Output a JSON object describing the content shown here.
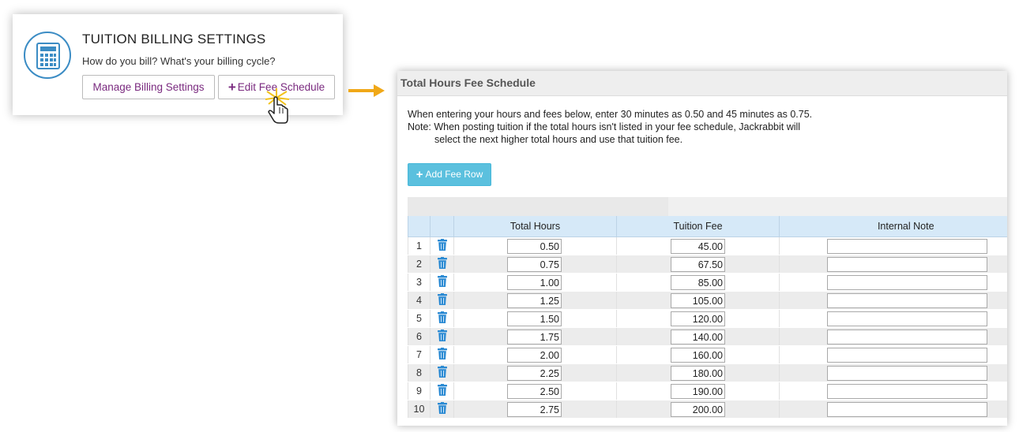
{
  "card": {
    "title": "TUITION BILLING SETTINGS",
    "subtitle": "How do you bill? What's your billing cycle?",
    "manage_label": "Manage Billing Settings",
    "edit_label": "Edit Fee Schedule",
    "icon": "calculator-icon"
  },
  "panel": {
    "title": "Total Hours Fee Schedule",
    "instr_line1": "When entering your hours and fees below, enter 30 minutes as 0.50 and 45 minutes as 0.75.",
    "instr_line2": "Note: When posting tuition if the total hours isn't listed in your fee schedule, Jackrabbit will",
    "instr_line3": "select the next higher total hours and use that tuition fee.",
    "add_row_label": "Add Fee Row",
    "columns": [
      "",
      "",
      "Total Hours",
      "Tuition Fee",
      "Internal Note"
    ],
    "rows": [
      {
        "n": "1",
        "hours": "0.50",
        "fee": "45.00",
        "note": ""
      },
      {
        "n": "2",
        "hours": "0.75",
        "fee": "67.50",
        "note": ""
      },
      {
        "n": "3",
        "hours": "1.00",
        "fee": "85.00",
        "note": ""
      },
      {
        "n": "4",
        "hours": "1.25",
        "fee": "105.00",
        "note": ""
      },
      {
        "n": "5",
        "hours": "1.50",
        "fee": "120.00",
        "note": ""
      },
      {
        "n": "6",
        "hours": "1.75",
        "fee": "140.00",
        "note": ""
      },
      {
        "n": "7",
        "hours": "2.00",
        "fee": "160.00",
        "note": ""
      },
      {
        "n": "8",
        "hours": "2.25",
        "fee": "180.00",
        "note": ""
      },
      {
        "n": "9",
        "hours": "2.50",
        "fee": "190.00",
        "note": ""
      },
      {
        "n": "10",
        "hours": "2.75",
        "fee": "200.00",
        "note": ""
      }
    ]
  },
  "colors": {
    "accent": "#5bc0de",
    "header_blue": "#d6e9f8",
    "arrow": "#f0a818",
    "link_purple": "#7a2a7f",
    "trash_blue": "#2b8ad3"
  }
}
